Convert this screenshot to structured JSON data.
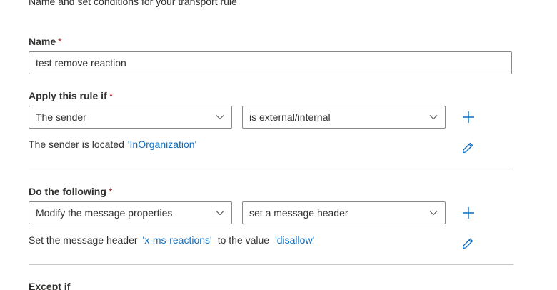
{
  "header": {
    "subtitle": "Name and set conditions for your transport rule"
  },
  "name_field": {
    "label": "Name",
    "required_mark": "*",
    "value": "test remove reaction"
  },
  "condition": {
    "label": "Apply this rule if",
    "required_mark": "*",
    "dropdown1": "The sender",
    "dropdown2": "is external/internal",
    "desc_prefix": "The sender is located",
    "desc_value": "'InOrganization'"
  },
  "action": {
    "label": "Do the following",
    "required_mark": "*",
    "dropdown1": "Modify the message properties",
    "dropdown2": "set a message header",
    "desc_prefix": "Set the message header",
    "desc_header": "'x-ms-reactions'",
    "desc_middle": "to the value",
    "desc_value": "'disallow'"
  },
  "exception": {
    "label": "Except if"
  },
  "icons": {
    "chevron": "chevron-down-icon",
    "add": "add-icon",
    "edit": "pencil-icon"
  },
  "colors": {
    "link": "#0f6cbd",
    "required": "#a4262c",
    "icon": "#0f6cbd",
    "border": "#8a8886",
    "divider": "#c8c6c4"
  }
}
